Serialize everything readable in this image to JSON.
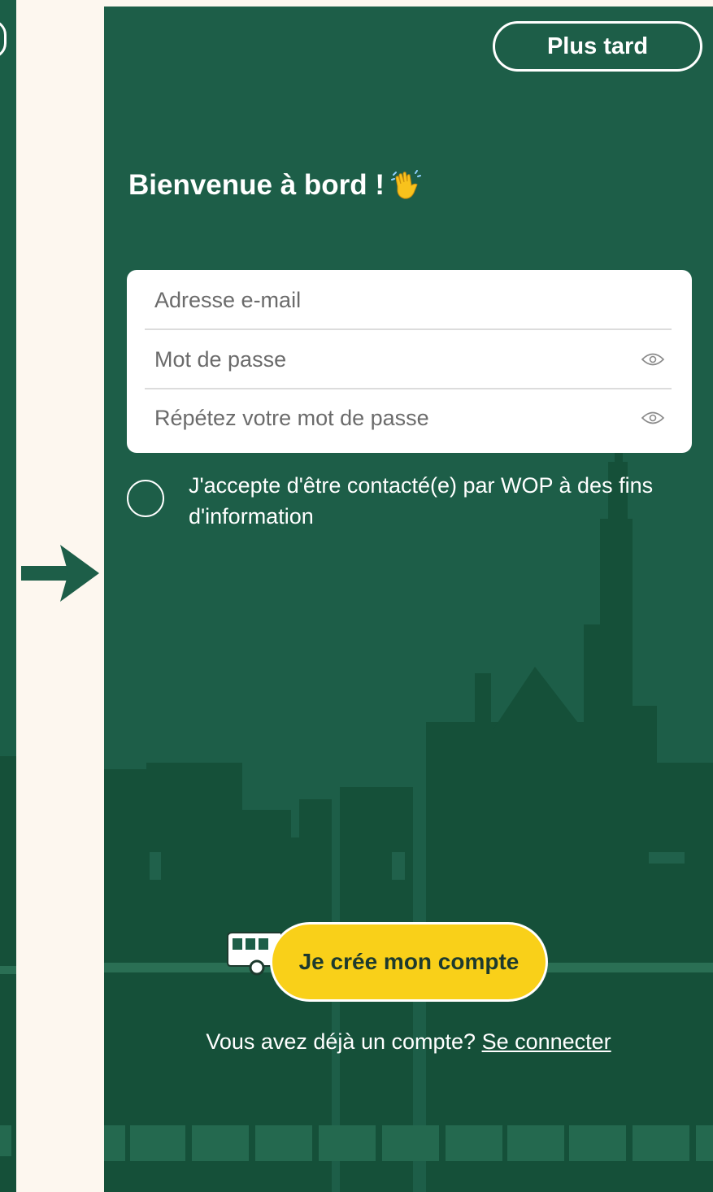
{
  "colors": {
    "background": "#fdf7ef",
    "phone_bg": "#1d5e48",
    "skyline": "#155039",
    "accent_yellow": "#f9d019",
    "text_white": "#ffffff"
  },
  "header": {
    "later_label": "Plus tard"
  },
  "welcome": {
    "title": "Bienvenue à bord !",
    "emoji_icon": "waving-hand-icon"
  },
  "form": {
    "email_placeholder": "Adresse e-mail",
    "password_placeholder": "Mot de passe",
    "repeat_placeholder": "Répétez votre mot de passe",
    "eye_icon": "eye-icon"
  },
  "consent": {
    "label": "J'accepte d'être contacté(e) par WOP à des fins d'information",
    "checked": false
  },
  "cta": {
    "label": "Je crée mon compte",
    "icon": "bus-icon"
  },
  "login": {
    "prompt": "Vous avez déjà un compte?",
    "link_label": "Se connecter"
  },
  "decor": {
    "arrow_icon": "arrow-right-icon"
  }
}
